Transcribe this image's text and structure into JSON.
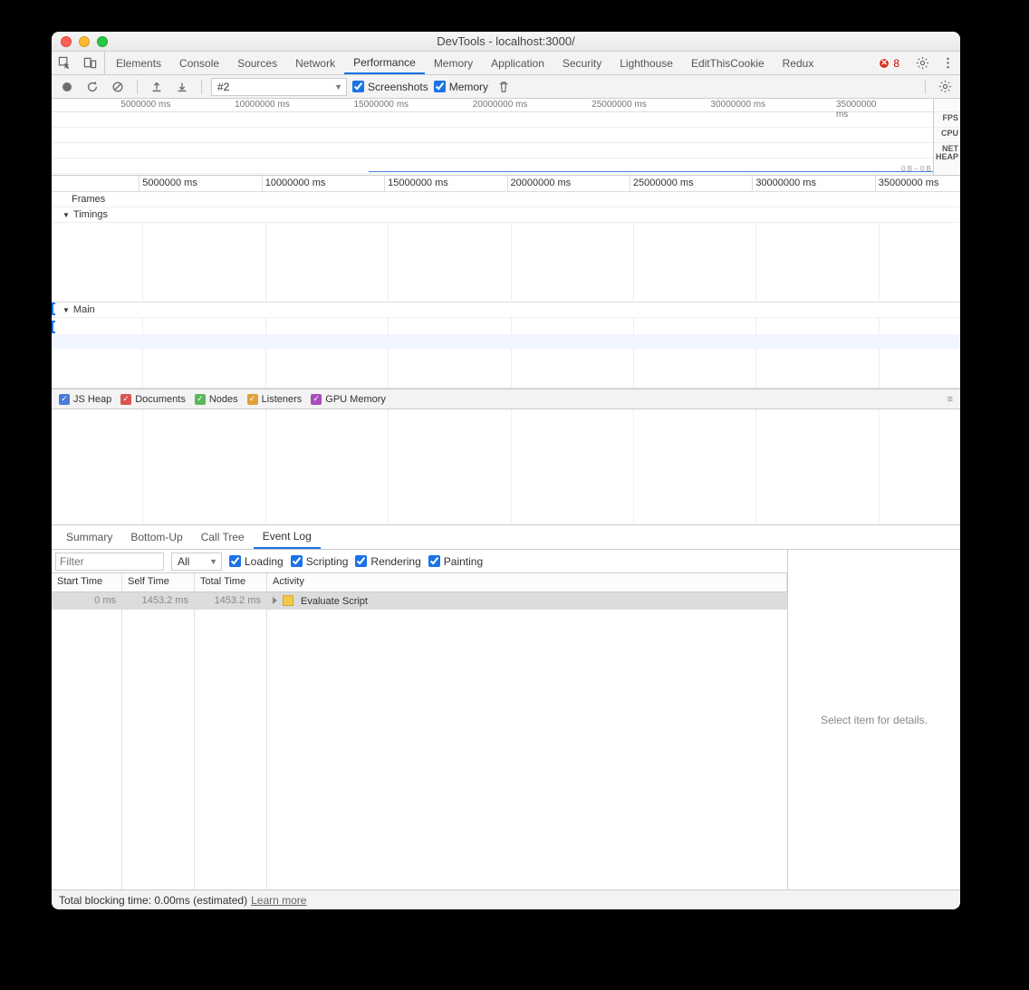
{
  "window": {
    "title": "DevTools - localhost:3000/"
  },
  "main_tabs": [
    "Elements",
    "Console",
    "Sources",
    "Network",
    "Performance",
    "Memory",
    "Application",
    "Security",
    "Lighthouse",
    "EditThisCookie",
    "Redux"
  ],
  "main_active_tab": "Performance",
  "error_count": "8",
  "toolbar": {
    "profile_select": "#2",
    "screenshots_label": "Screenshots",
    "memory_label": "Memory"
  },
  "overview": {
    "ticks": [
      "5000000 ms",
      "10000000 ms",
      "15000000 ms",
      "20000000 ms",
      "25000000 ms",
      "30000000 ms",
      "35000000 ms"
    ],
    "side": [
      "FPS",
      "CPU",
      "NET",
      "HEAP"
    ],
    "heap_footer": "0 B – 0 B"
  },
  "flame": {
    "ticks": [
      "5000000 ms",
      "10000000 ms",
      "15000000 ms",
      "20000000 ms",
      "25000000 ms",
      "30000000 ms",
      "35000000 ms"
    ],
    "frames_label": "Frames",
    "timings_label": "Timings",
    "main_label": "Main"
  },
  "memory_legend": {
    "items": [
      {
        "label": "JS Heap",
        "color": "#4a7dd6"
      },
      {
        "label": "Documents",
        "color": "#d9534f"
      },
      {
        "label": "Nodes",
        "color": "#5cb85c"
      },
      {
        "label": "Listeners",
        "color": "#e0a13b"
      },
      {
        "label": "GPU Memory",
        "color": "#a94dbd"
      }
    ]
  },
  "detail_tabs": [
    "Summary",
    "Bottom-Up",
    "Call Tree",
    "Event Log"
  ],
  "detail_active": "Event Log",
  "filter": {
    "placeholder": "Filter",
    "scope": "All",
    "loading": "Loading",
    "scripting": "Scripting",
    "rendering": "Rendering",
    "painting": "Painting"
  },
  "grid": {
    "cols": [
      "Start Time",
      "Self Time",
      "Total Time",
      "Activity"
    ],
    "rows": [
      {
        "start": "0 ms",
        "self": "1453.2 ms",
        "total": "1453.2 ms",
        "activity": "Evaluate Script"
      }
    ]
  },
  "details_empty": "Select item for details.",
  "status": {
    "text": "Total blocking time: 0.00ms (estimated)",
    "link": "Learn more"
  }
}
